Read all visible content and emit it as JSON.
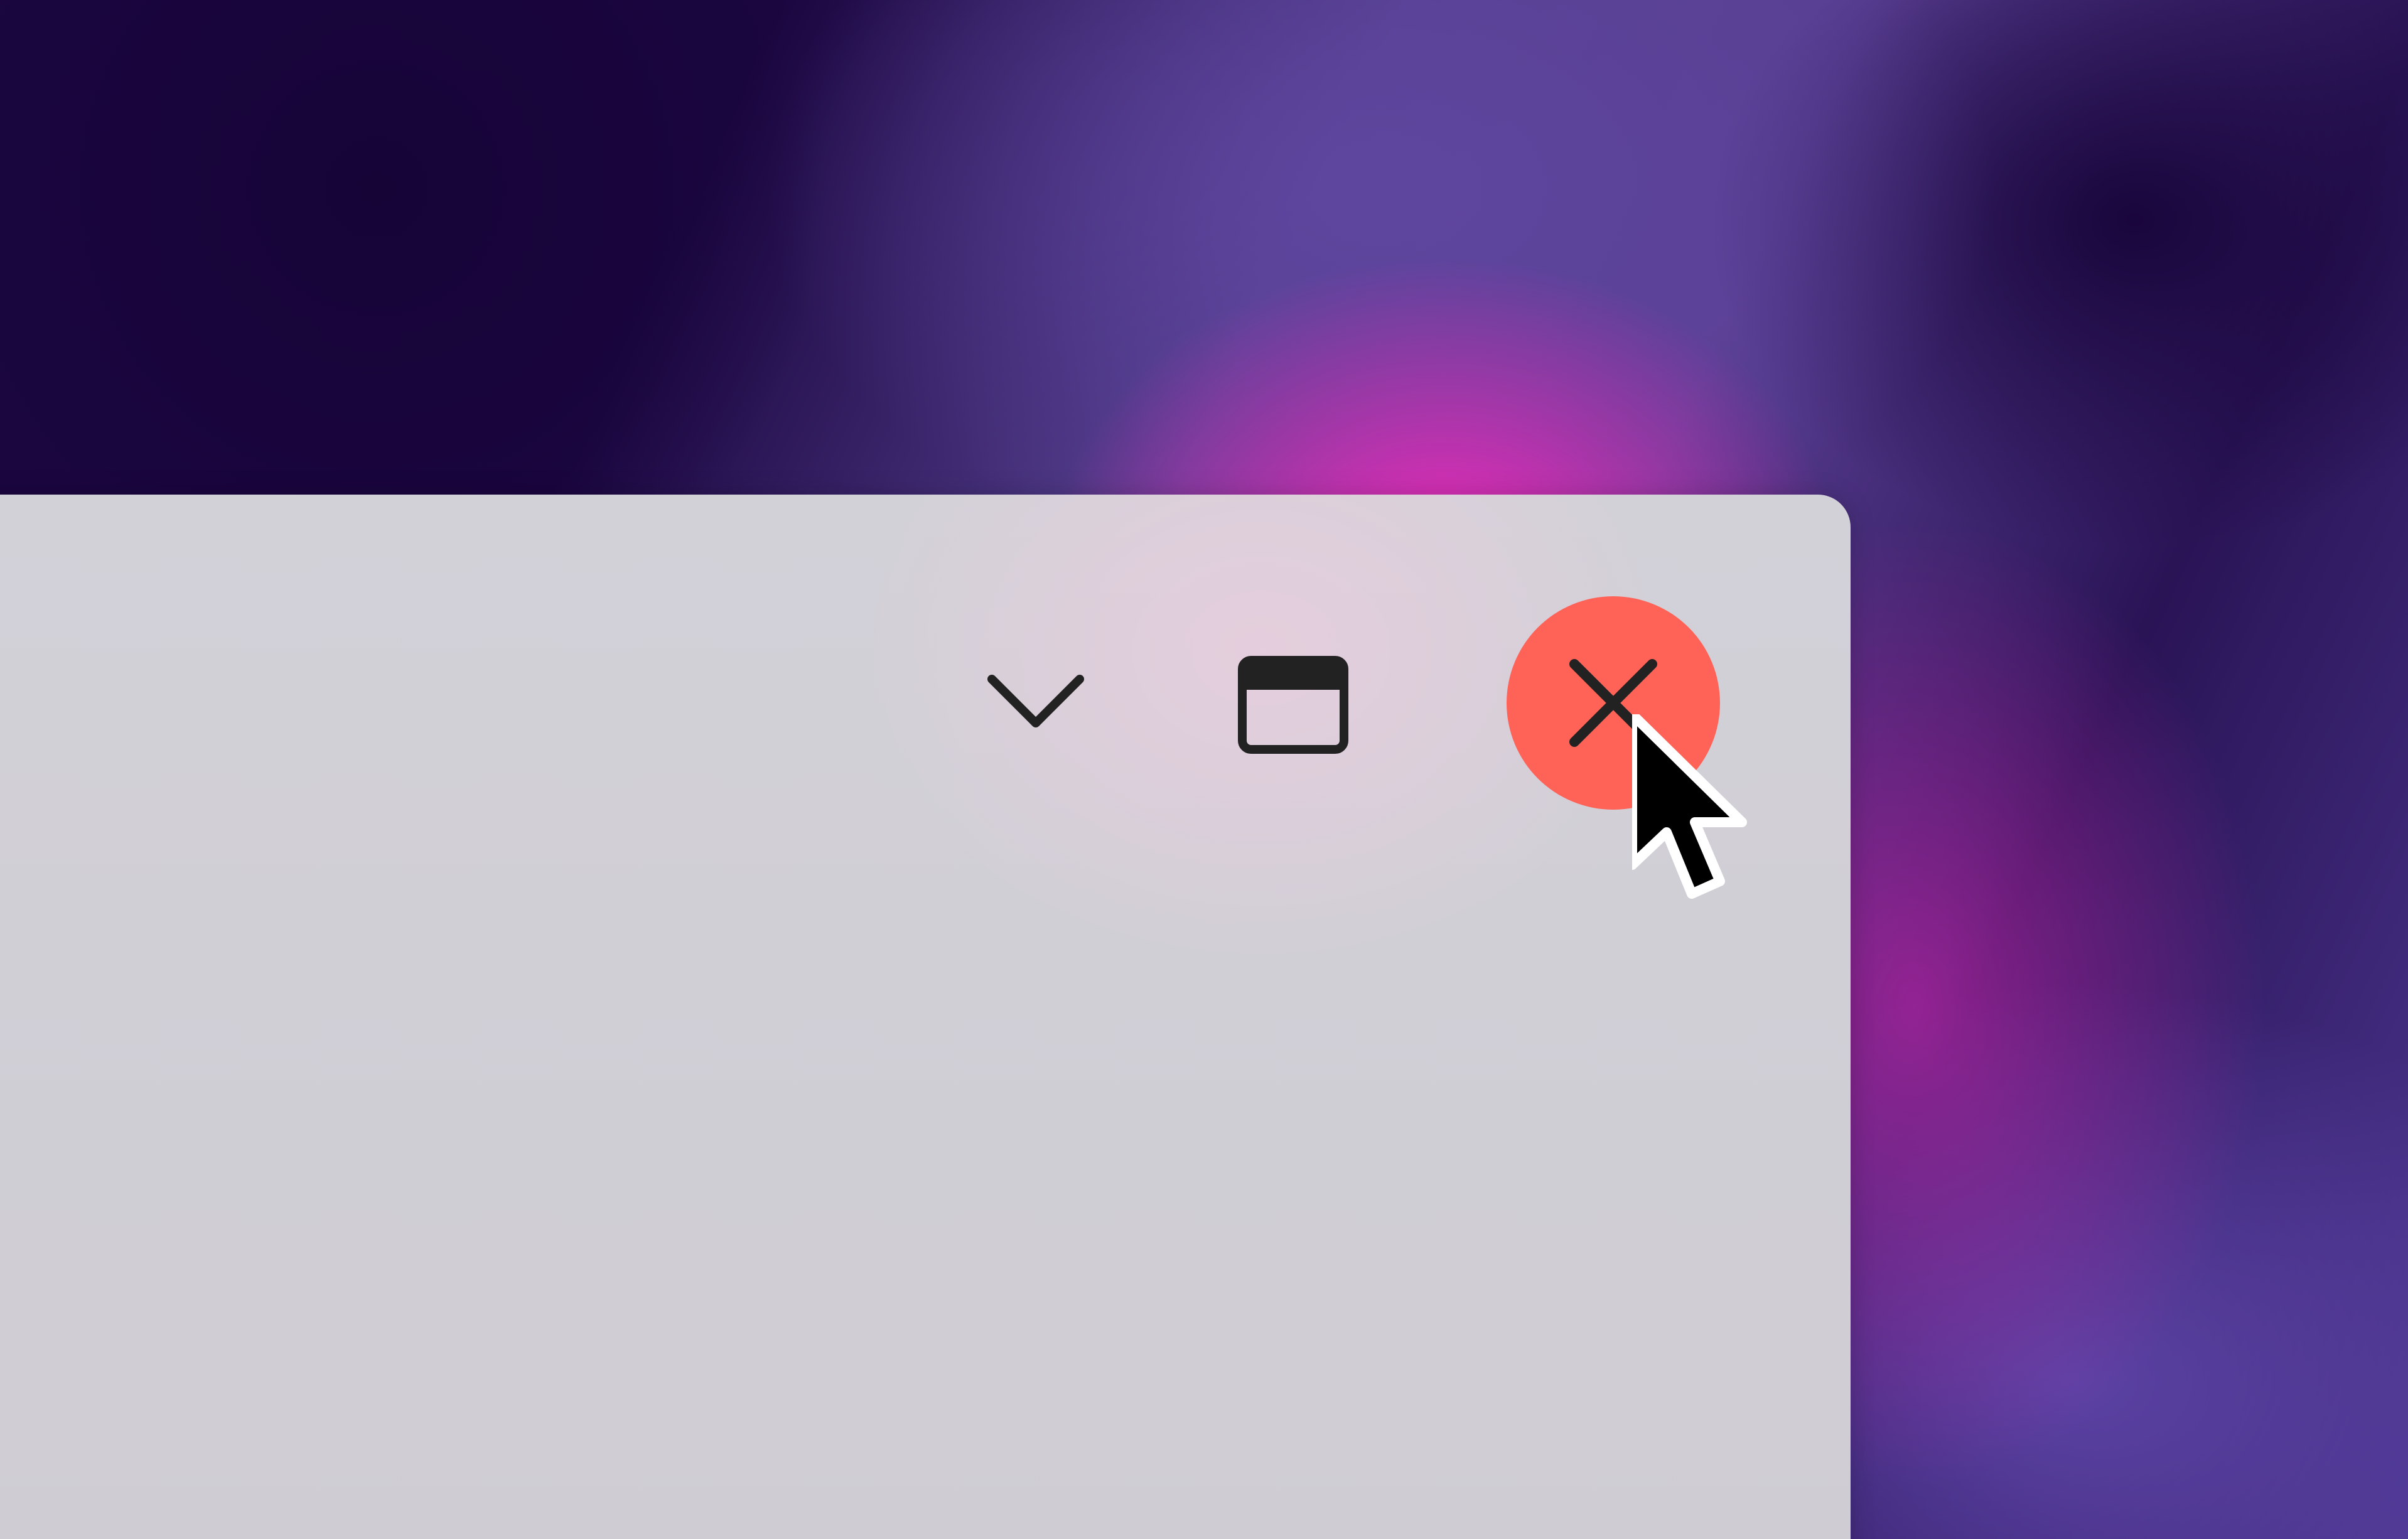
{
  "window": {
    "controls": {
      "minimize": {
        "icon": "chevron-down-icon",
        "tooltip": ""
      },
      "maximize": {
        "icon": "window-maximize-icon",
        "tooltip": ""
      },
      "close": {
        "icon": "close-icon",
        "hover_color": "#ff6257",
        "state": "hovered"
      }
    }
  },
  "colors": {
    "window_background": "#d1cfd6",
    "icon_color": "#222222",
    "close_hover": "#ff6257"
  },
  "cursor": {
    "icon": "arrow-cursor-icon"
  }
}
